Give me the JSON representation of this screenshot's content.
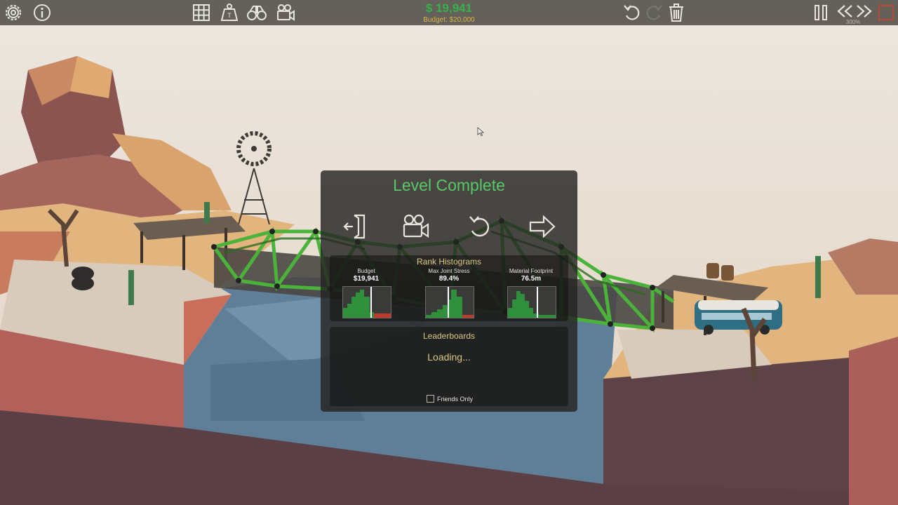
{
  "toolbar": {
    "money": "$ 19,941",
    "budget": "Budget: $20,000",
    "speed": "300%"
  },
  "modal": {
    "title": "Level Complete",
    "rank_title": "Rank Histograms",
    "histograms": [
      {
        "label": "Budget",
        "value": "$19,941"
      },
      {
        "label": "Max Joint Stress",
        "value": "89.4%"
      },
      {
        "label": "Material Footprint",
        "value": "76.5m"
      }
    ],
    "leaderboards_title": "Leaderboards",
    "loading": "Loading...",
    "friends_only": "Friends Only"
  },
  "colors": {
    "accent_green": "#59c867",
    "money_green": "#35b34a",
    "budget_gold": "#d6b64a",
    "panel_text": "#d8c684"
  },
  "icons": [
    "settings-icon",
    "info-icon",
    "grid-icon",
    "weight-icon",
    "binoculars-icon",
    "camera-icon",
    "undo-icon",
    "redo-icon",
    "trash-icon",
    "pause-icon",
    "rewind-icon",
    "fast-forward-icon",
    "stop-icon",
    "exit-icon",
    "replay-camera-icon",
    "retry-icon",
    "next-level-icon"
  ]
}
